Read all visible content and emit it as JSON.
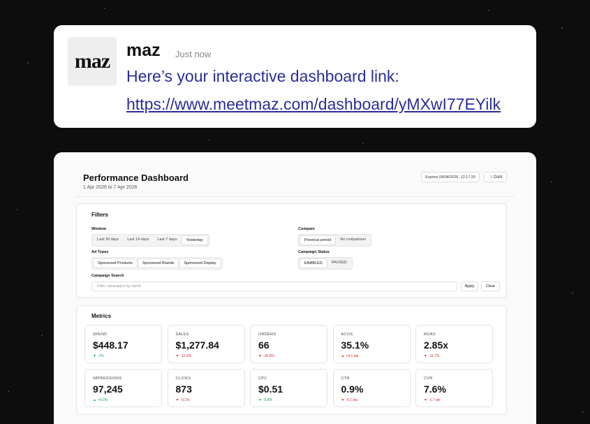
{
  "message": {
    "logo_text": "maz",
    "sender": "maz",
    "time": "Just now",
    "text": "Here’s your interactive dashboard link:",
    "link": "https://www.meetmaz.com/dashboard/yMXwI77EYilk"
  },
  "dashboard": {
    "title": "Performance Dashboard",
    "date_range": "1 Apr 2026 to 7 Apr 2026",
    "expires": "Expires 09/04/2026, 12:17:26",
    "theme_icon": "moon-icon",
    "theme_label": "Dark",
    "filters": {
      "title": "Filters",
      "window_label": "Window",
      "window_options": [
        "Last 30 days",
        "Last 14 days",
        "Last 7 days",
        "Yesterday"
      ],
      "window_selected": "Yesterday",
      "compare_label": "Compare",
      "compare_options": [
        "Previous period",
        "No comparison"
      ],
      "compare_selected": "Previous period",
      "ad_types_label": "Ad Types",
      "ad_types_options": [
        "Sponsored Products",
        "Sponsored Brands",
        "Sponsored Display"
      ],
      "status_label": "Campaign Status",
      "status_options": [
        "ENABLED",
        "PAUSED"
      ],
      "status_selected": "ENABLED",
      "search_label": "Campaign Search",
      "search_placeholder": "Filter campaigns by name",
      "apply_label": "Apply",
      "clear_label": "Clear"
    },
    "metrics": {
      "title": "Metrics",
      "items": [
        {
          "label": "SPEND",
          "value": "$448.17",
          "delta": "-1%",
          "dir": "down",
          "color": "up"
        },
        {
          "label": "SALES",
          "value": "$1,277.84",
          "delta": "-12.6%",
          "dir": "down",
          "color": "down"
        },
        {
          "label": "ORDERS",
          "value": "66",
          "delta": "-18.5%",
          "dir": "down",
          "color": "down"
        },
        {
          "label": "ACOS",
          "value": "35.1%",
          "delta": "+4.1 pts",
          "dir": "up",
          "color": "down"
        },
        {
          "label": "ROAS",
          "value": "2.85x",
          "delta": "-11.7%",
          "dir": "down",
          "color": "down"
        },
        {
          "label": "IMPRESSIONS",
          "value": "97,245",
          "delta": "+9.3%",
          "dir": "up",
          "color": "up"
        },
        {
          "label": "CLICKS",
          "value": "873",
          "delta": "-0.1%",
          "dir": "down",
          "color": "down"
        },
        {
          "label": "CPC",
          "value": "$0.51",
          "delta": "-0.8%",
          "dir": "down",
          "color": "up"
        },
        {
          "label": "CTR",
          "value": "0.9%",
          "delta": "-0.1 pts",
          "dir": "down",
          "color": "down"
        },
        {
          "label": "CVR",
          "value": "7.6%",
          "delta": "-1.7 pts",
          "dir": "down",
          "color": "down"
        }
      ]
    }
  }
}
